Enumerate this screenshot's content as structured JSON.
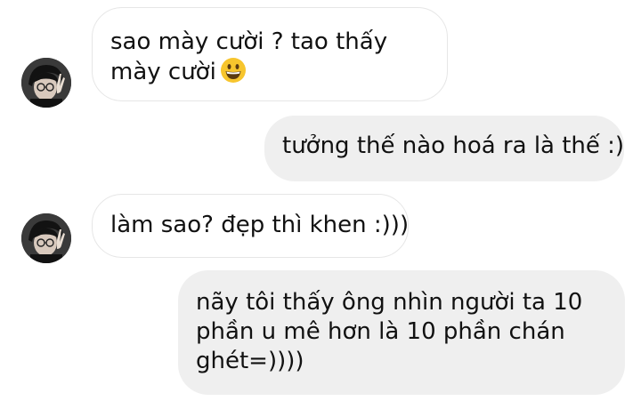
{
  "messages": [
    {
      "direction": "incoming",
      "text": "sao mày cười ? tao thấy mày cười",
      "emoji": "grinning-face-emoji"
    },
    {
      "direction": "outgoing",
      "text": "tưởng thế nào hoá ra là thế :)"
    },
    {
      "direction": "incoming",
      "text": "làm sao? đẹp thì khen :)))"
    },
    {
      "direction": "outgoing",
      "text": "nãy tôi thấy ông nhìn người ta 10 phần u mê hơn là 10 phần chán ghét=))))"
    }
  ],
  "icons": {
    "contact_avatar": "avatar-photo",
    "emoji": "grinning-face-emoji"
  },
  "colors": {
    "outgoing_bubble": "#efefef",
    "incoming_bubble": "#ffffff",
    "incoming_border": "#e6e6e6",
    "text": "#111111",
    "emoji_yellow": "#f7c52d"
  }
}
